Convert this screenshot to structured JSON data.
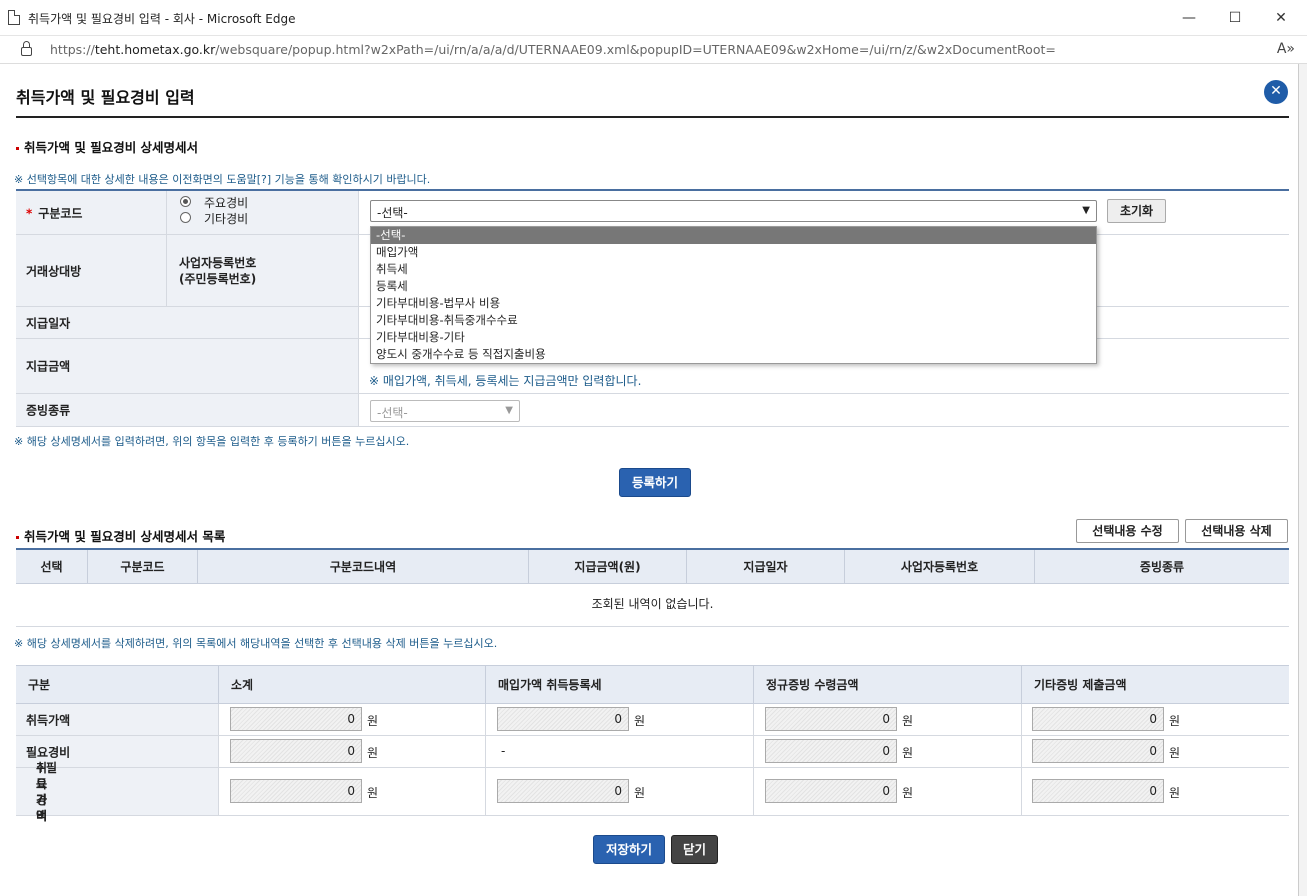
{
  "window": {
    "title": "취득가액 및 필요경비 입력 - 회사 - Microsoft Edge",
    "url_prefix": "https://",
    "url_host": "teht.hometax.go.kr",
    "url_rest": "/websquare/popup.html?w2xPath=/ui/rn/a/a/a/d/UTERNAAE09.xml&popupID=UTERNAAE09&w2xHome=/ui/rn/z/&w2xDocumentRoot=",
    "minimize": "—",
    "maximize": "☐",
    "close": "✕",
    "read_aloud": "A»"
  },
  "popup": {
    "title": "취득가액 및 필요경비 입력",
    "close_icon": "✕"
  },
  "detail": {
    "section_title": "취득가액 및 필요경비 상세명세서",
    "help_note": "※ 선택항목에 대한 상세한 내용은 이전화면의 도움말[?] 기능을 통해 확인하시기 바랍니다.",
    "code_label": "구분코드",
    "required_mark": "*",
    "radio_main": "주요경비",
    "radio_other": "기타경비",
    "code_select_value": "-선택-",
    "reset_button": "초기화",
    "partner_label": "거래상대방",
    "bizno_label_1": "사업자등록번호",
    "bizno_label_2": "(주민등록번호)",
    "pay_date_label": "지급일자",
    "pay_amount_label": "지급금액",
    "pay_amount_note": "※ 매입가액, 취득세, 등록세는 지급금액만 입력합니다.",
    "evidence_label": "증빙종류",
    "evidence_select_value": "-선택-",
    "register_note": "※ 해당 상세명세서를 입력하려면, 위의 항목을 입력한 후 등록하기 버튼을 누르십시오.",
    "register_button": "등록하기",
    "dropdown_options": [
      "-선택-",
      "매입가액",
      "취득세",
      "등록세",
      "기타부대비용-법무사 비용",
      "기타부대비용-취득중개수수료",
      "기타부대비용-기타",
      "양도시 중개수수료 등 직접지출비용"
    ]
  },
  "list": {
    "section_title": "취득가액 및 필요경비 상세명세서 목록",
    "edit_button": "선택내용 수정",
    "delete_button": "선택내용 삭제",
    "columns": [
      "선택",
      "구분코드",
      "구분코드내역",
      "지급금액(원)",
      "지급일자",
      "사업자등록번호",
      "증빙종류"
    ],
    "empty_message": "조회된 내역이 없습니다.",
    "delete_note": "※ 해당 상세명세서를 삭제하려면, 위의 목록에서 해당내역을 선택한 후 선택내용 삭제 버튼을 누르십시오."
  },
  "summary": {
    "columns": [
      "구분",
      "소계",
      "매입가액 취득등록세",
      "정규증빙 수령금액",
      "기타증빙 제출금액"
    ],
    "unit": "원",
    "rows": [
      {
        "label_1": "취득가액",
        "label_2": "",
        "values": [
          "0",
          "0",
          "0",
          "0"
        ]
      },
      {
        "label_1": "필요경비",
        "label_2": "",
        "values": [
          "0",
          "-",
          "0",
          "0"
        ]
      },
      {
        "label_1": "취득가액",
        "label_2": "+필요경비",
        "values": [
          "0",
          "0",
          "0",
          "0"
        ]
      }
    ]
  },
  "footer": {
    "save_button": "저장하기",
    "close_button": "닫기"
  },
  "colors": {
    "primary_blue": "#2a62b0",
    "header_bg": "#e7ecf4",
    "note_blue": "#1c5b8a"
  }
}
